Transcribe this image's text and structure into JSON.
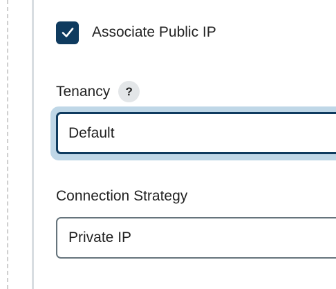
{
  "public_ip": {
    "label": "Associate Public IP",
    "checked": true
  },
  "tenancy": {
    "label": "Tenancy",
    "help": "?",
    "value": "Default"
  },
  "connection_strategy": {
    "label": "Connection Strategy",
    "value": "Private IP"
  },
  "colors": {
    "checkbox_fill": "#0f3b5f",
    "focus_ring": "#bfd7e7",
    "input_border_focused": "#0f3b5f",
    "input_border": "#66747c"
  }
}
